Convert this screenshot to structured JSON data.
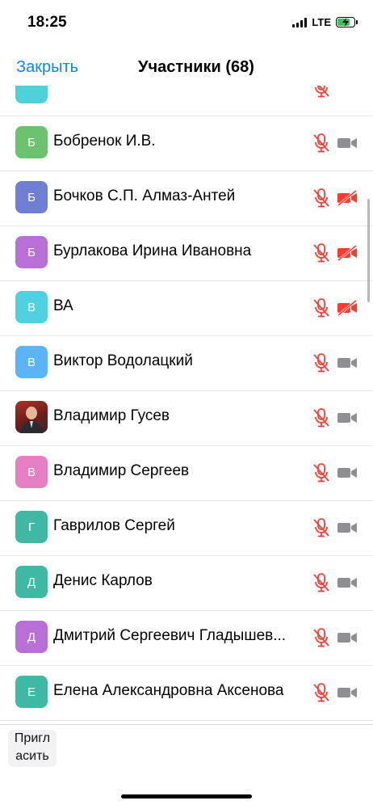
{
  "status": {
    "time": "18:25",
    "network": "LTE",
    "battery_level": 0.8
  },
  "nav": {
    "close": "Закрыть",
    "title": "Участники (68)"
  },
  "participants": [
    {
      "initial": "",
      "name": "",
      "avatar_color": "#4fd1d9",
      "mic_muted": true,
      "video_off": false
    },
    {
      "initial": "Б",
      "name": "Бобренок И.В.",
      "avatar_color": "#6cc26f",
      "mic_muted": true,
      "video_off": false
    },
    {
      "initial": "Б",
      "name": "Бочков С.П. Алмаз-Антей",
      "avatar_color": "#6f7fd6",
      "mic_muted": true,
      "video_off": true
    },
    {
      "initial": "Б",
      "name": "Бурлакова Ирина Ивановна",
      "avatar_color": "#b86fd6",
      "mic_muted": true,
      "video_off": true
    },
    {
      "initial": "В",
      "name": "ВА",
      "avatar_color": "#4fd1e0",
      "mic_muted": true,
      "video_off": true
    },
    {
      "initial": "В",
      "name": "Виктор Водолацкий",
      "avatar_color": "#5ab4f5",
      "mic_muted": true,
      "video_off": false
    },
    {
      "initial": "",
      "name": "Владимир Гусев",
      "avatar_color": "#8a2b25",
      "photo": true,
      "mic_muted": true,
      "video_off": false
    },
    {
      "initial": "В",
      "name": "Владимир Сергеев",
      "avatar_color": "#e57fc2",
      "mic_muted": true,
      "video_off": false
    },
    {
      "initial": "Г",
      "name": "Гаврилов Сергей",
      "avatar_color": "#3fb8a4",
      "mic_muted": true,
      "video_off": false
    },
    {
      "initial": "Д",
      "name": "Денис Карлов",
      "avatar_color": "#3fb8a4",
      "mic_muted": true,
      "video_off": false
    },
    {
      "initial": "Д",
      "name": "Дмитрий Сергеевич Гладышев...",
      "avatar_color": "#b86fd6",
      "mic_muted": true,
      "video_off": false
    },
    {
      "initial": "Е",
      "name": "Елена Александровна Аксенова",
      "avatar_color": "#3fb8a4",
      "mic_muted": true,
      "video_off": false
    },
    {
      "initial": "",
      "name": "",
      "avatar_color": "#d8d2c4",
      "mic_muted": false,
      "video_off": false
    }
  ],
  "bottom": {
    "invite_line1": "Пригл",
    "invite_line2": "асить"
  },
  "colors": {
    "accent": "#0a84ff",
    "muted_red": "#ff3b30",
    "icon_gray": "#8e8e93"
  }
}
